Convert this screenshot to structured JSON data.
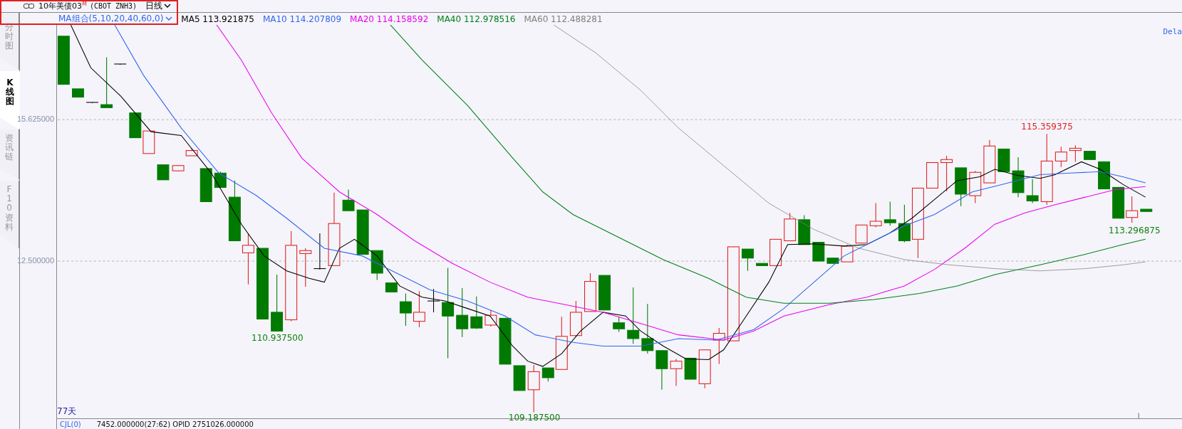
{
  "header": {
    "link_label": "10年美债03",
    "flag": "M",
    "code": "(CBOT ZNH3)",
    "period": "日线"
  },
  "side_tabs": [
    {
      "label": "分时图",
      "selected": false
    },
    {
      "label": "K线图",
      "selected": true
    },
    {
      "label": "资讯链",
      "selected": false
    },
    {
      "label": "F10资料",
      "selected": false
    }
  ],
  "indicator_bar": {
    "label": "MA组合(5,10,20,40,60,0)",
    "values": [
      {
        "text": "MA5 113.921875",
        "color": "#000000"
      },
      {
        "text": "MA10 114.207809",
        "color": "#3366ee"
      },
      {
        "text": "MA20 114.158592",
        "color": "#ee00ee"
      },
      {
        "text": "MA40 112.978516",
        "color": "#00801a"
      },
      {
        "text": "MA60 112.488281",
        "color": "#808080"
      }
    ]
  },
  "delay_label": "Dela",
  "price_axis": [
    {
      "label": "15.625000"
    },
    {
      "label": "12.500000"
    }
  ],
  "annotations": [
    {
      "text": "115.359375",
      "kind": "high"
    },
    {
      "text": "113.296875",
      "kind": "low"
    },
    {
      "text": "110.937500",
      "kind": "low"
    },
    {
      "text": "109.187500",
      "kind": "low"
    }
  ],
  "day_count": "77天",
  "volume_bar": {
    "label": "CJL(0)",
    "text": "7452.000000(27:62)  OPID 2751026.000000"
  }
}
